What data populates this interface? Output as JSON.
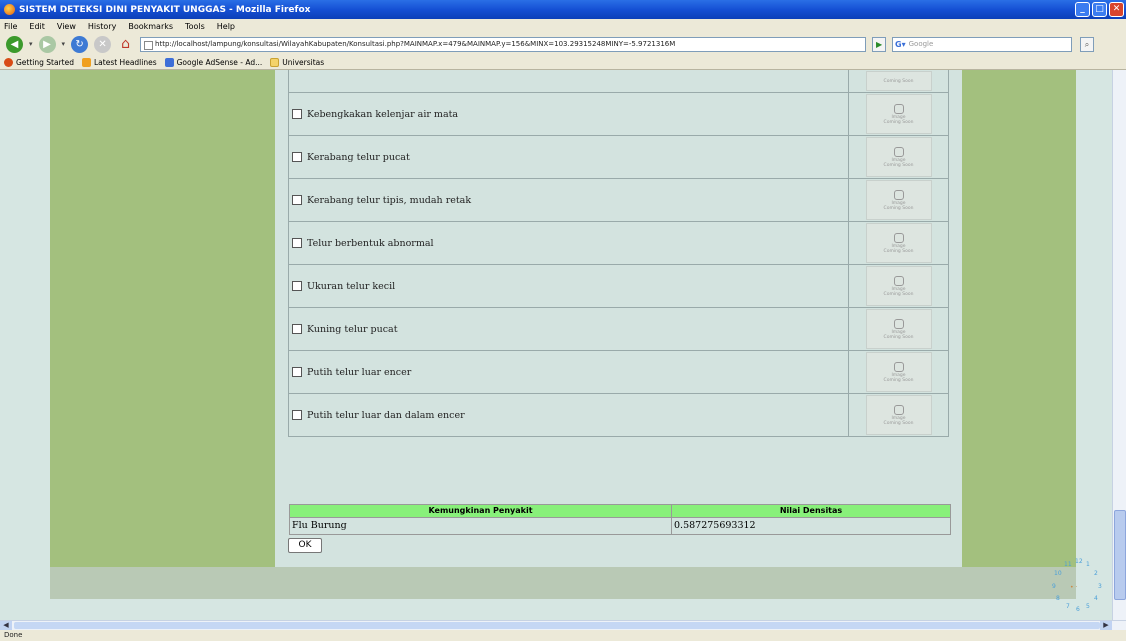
{
  "window": {
    "title": "SISTEM DETEKSI DINI PENYAKIT UNGGAS - Mozilla Firefox"
  },
  "menu": [
    "File",
    "Edit",
    "View",
    "History",
    "Bookmarks",
    "Tools",
    "Help"
  ],
  "navigation": {
    "url": "http://localhost/lampung/konsultasi/WilayahKabupaten/Konsultasi.php?MAINMAP.x=479&MAINMAP.y=156&MINX=103.29315248MINY=-5.9721316M",
    "search_placeholder": "Google"
  },
  "bookmarks": [
    {
      "label": "Getting Started",
      "color": "#d84b16"
    },
    {
      "label": "Latest Headlines",
      "color": "#f0a020"
    },
    {
      "label": "Google AdSense - Ad...",
      "color": "#3e6fd8"
    },
    {
      "label": "Universitas",
      "color": "#f4d36a"
    }
  ],
  "symptoms": [
    "",
    "Kebengkakan kelenjar air mata",
    "Kerabang telur pucat",
    "Kerabang telur tipis, mudah retak",
    "Telur berbentuk abnormal",
    "Ukuran telur kecil",
    "Kuning telur pucat",
    "Putih telur luar encer",
    "Putih telur luar dan dalam encer"
  ],
  "image_placeholder": {
    "line1": "Image",
    "line2": "Coming Soon"
  },
  "ok_label": "OK",
  "result": {
    "headers": [
      "Kemungkinan Penyakit",
      "Nilai Densitas"
    ],
    "disease": "Flu Burung",
    "density": "0.587275693312"
  },
  "status": "Done"
}
